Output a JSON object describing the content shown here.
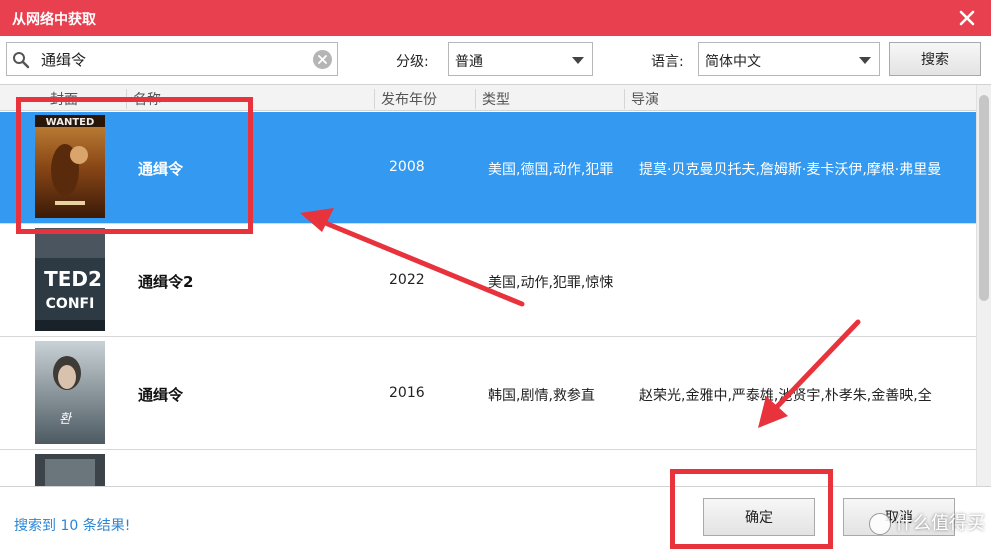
{
  "window": {
    "title": "从网络中获取",
    "close_icon": "close-icon"
  },
  "search": {
    "value": "通缉令",
    "icon": "search-icon",
    "clear_icon": "clear-icon"
  },
  "filters": {
    "rating_label": "分级:",
    "rating_value": "普通",
    "language_label": "语言:",
    "language_value": "简体中文",
    "search_button": "搜索"
  },
  "table": {
    "columns": [
      "封面",
      "名称",
      "发布年份",
      "类型",
      "导演"
    ],
    "rows": [
      {
        "name": "通缉令",
        "year": "2008",
        "type": "美国,德国,动作,犯罪",
        "director": "提莫·贝克曼贝托夫,詹姆斯·麦卡沃伊,摩根·弗里曼",
        "selected": true,
        "cover_color": "#7a3b12"
      },
      {
        "name": "通缉令2",
        "year": "2022",
        "type": "美国,动作,犯罪,惊悚",
        "director": "",
        "selected": false,
        "cover_color": "#2d3a44"
      },
      {
        "name": "通缉令",
        "year": "2016",
        "type": "韩国,剧情,救参直",
        "director": "赵荣光,金雅中,严泰雄,池贤宇,朴孝朱,金善映,全",
        "selected": false,
        "cover_color": "#7c8b95"
      },
      {
        "name": "",
        "year": "",
        "type": "",
        "director": "",
        "selected": false,
        "cover_color": "#3c4449"
      }
    ]
  },
  "footer": {
    "status": "搜索到 10 条结果!",
    "ok_button": "确定",
    "cancel_button": "取消",
    "watermark": "什么值得买"
  },
  "colors": {
    "titlebar": "#e8404f",
    "selected_row": "#3399f1",
    "annotation": "#e8333c",
    "status_text": "#2c86d4"
  }
}
